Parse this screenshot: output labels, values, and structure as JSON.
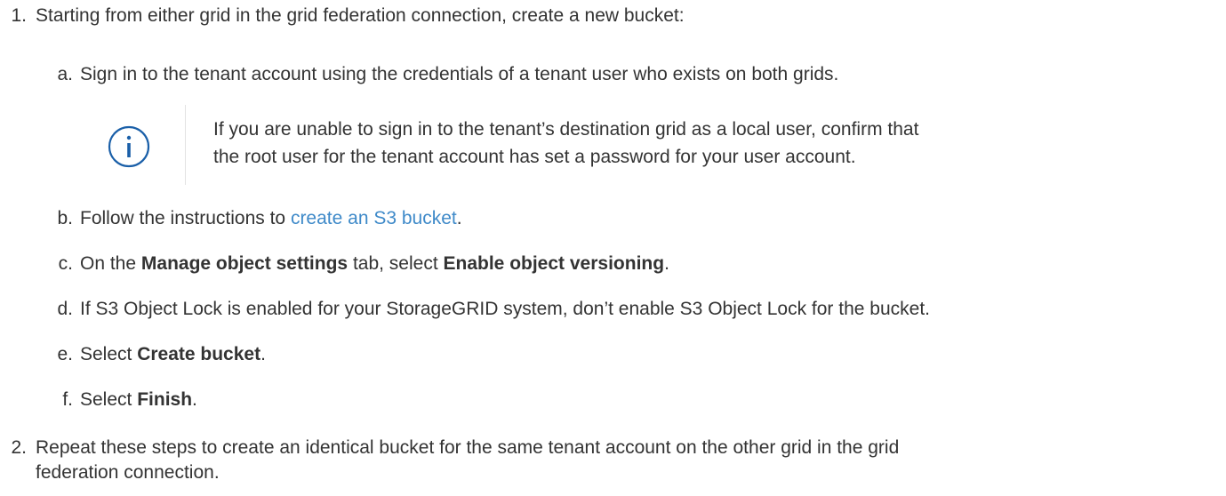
{
  "steps": [
    {
      "number": "1.",
      "text": "Starting from either grid in the grid federation connection, create a new bucket:",
      "substeps": [
        {
          "letter": "a.",
          "text": "Sign in to the tenant account using the credentials of a tenant user who exists on both grids."
        },
        {
          "letter": "b.",
          "prefix": "Follow the instructions to ",
          "link": "create an S3 bucket",
          "suffix": "."
        },
        {
          "letter": "c.",
          "prefix": "On the ",
          "bold1": "Manage object settings",
          "middle": " tab, select ",
          "bold2": "Enable object versioning",
          "suffix": "."
        },
        {
          "letter": "d.",
          "text": "If S3 Object Lock is enabled for your StorageGRID system, don’t enable S3 Object Lock for the bucket."
        },
        {
          "letter": "e.",
          "prefix": "Select ",
          "bold": "Create bucket",
          "suffix": "."
        },
        {
          "letter": "f.",
          "prefix": "Select ",
          "bold": "Finish",
          "suffix": "."
        }
      ]
    },
    {
      "number": "2.",
      "line1": "Repeat these steps to create an identical bucket for the same tenant account on the other grid in the grid",
      "line2": "federation connection."
    }
  ],
  "note": {
    "icon": "info-circle-icon",
    "line1": "If you are unable to sign in to the tenant’s destination grid as a local user, confirm that",
    "line2": "the root user for the tenant account has set a password for your user account."
  },
  "colors": {
    "text": "#333333",
    "link": "#3f8ac9",
    "icon": "#1a5fa8"
  }
}
